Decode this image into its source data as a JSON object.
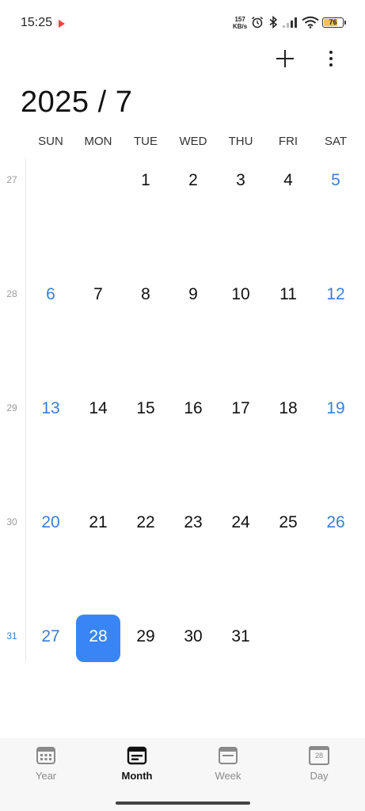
{
  "status_bar": {
    "time": "15:25",
    "network_speed_value": "157",
    "network_speed_unit": "KB/s",
    "battery_level": "76",
    "battery_percent": 76,
    "icons": [
      "play-store-icon",
      "alarm-icon",
      "bluetooth-icon",
      "signal-icon",
      "wifi-icon",
      "battery-icon"
    ]
  },
  "toolbar": {
    "icons": [
      "add-icon",
      "more-vertical-icon"
    ]
  },
  "header": {
    "title": "2025 / 7"
  },
  "weekdays": [
    "SUN",
    "MON",
    "TUE",
    "WED",
    "THU",
    "FRI",
    "SAT"
  ],
  "weeks": [
    {
      "week_number": "27",
      "days": [
        "",
        "",
        "1",
        "2",
        "3",
        "4",
        "5"
      ]
    },
    {
      "week_number": "28",
      "days": [
        "6",
        "7",
        "8",
        "9",
        "10",
        "11",
        "12"
      ]
    },
    {
      "week_number": "29",
      "days": [
        "13",
        "14",
        "15",
        "16",
        "17",
        "18",
        "19"
      ]
    },
    {
      "week_number": "30",
      "days": [
        "20",
        "21",
        "22",
        "23",
        "24",
        "25",
        "26"
      ]
    },
    {
      "week_number": "31",
      "days": [
        "27",
        "28",
        "29",
        "30",
        "31",
        "",
        ""
      ]
    }
  ],
  "selected_day": "28",
  "current_week": "31",
  "colors": {
    "accent": "#3a85f5",
    "weekend_text": "#3a7fd5",
    "battery_fill": "#f0c24a"
  },
  "bottom_nav": {
    "items": [
      {
        "label": "Year",
        "icon": "year-grid-icon",
        "active": false
      },
      {
        "label": "Month",
        "icon": "month-icon",
        "active": true
      },
      {
        "label": "Week",
        "icon": "week-icon",
        "active": false
      },
      {
        "label": "Day",
        "icon": "day-icon",
        "active": false,
        "badge": "28"
      }
    ]
  }
}
